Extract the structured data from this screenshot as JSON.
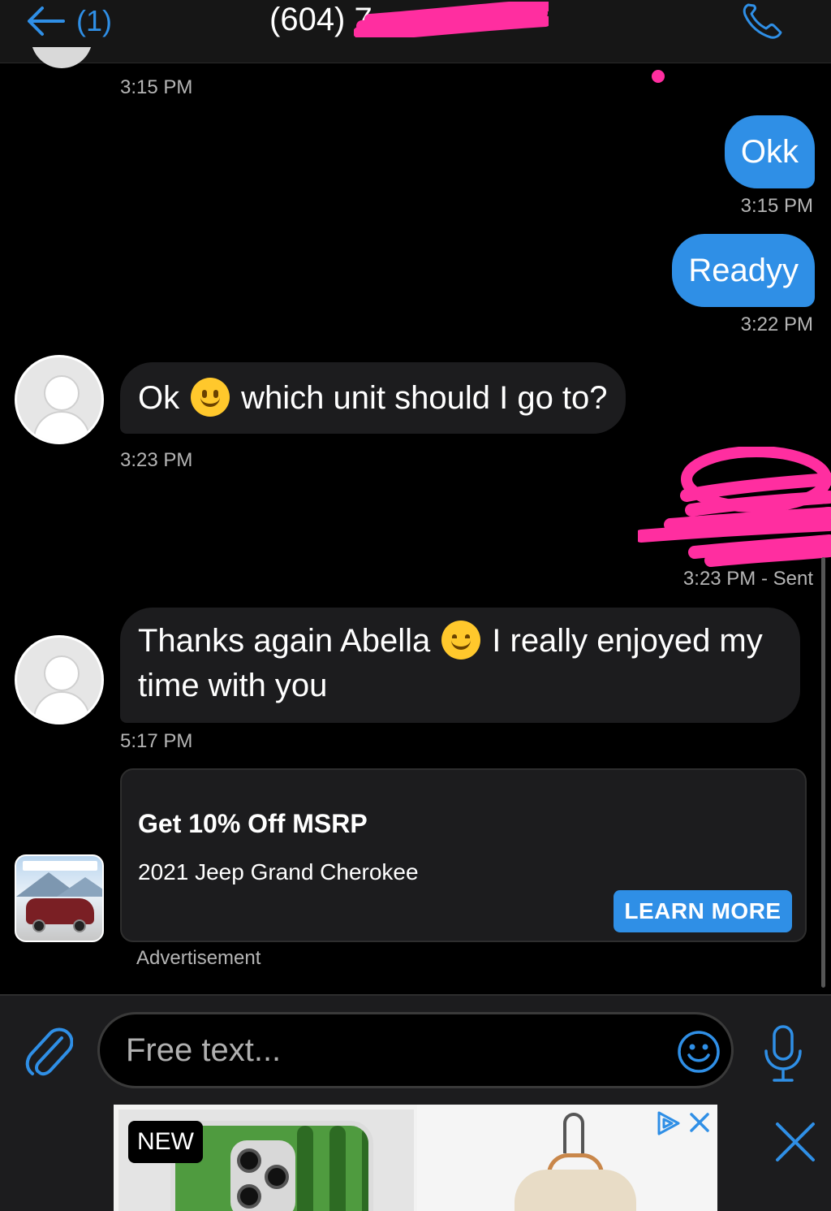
{
  "header": {
    "back_count": "(1)",
    "contact_number": "(604) 7",
    "icons": {
      "back": "arrow-left-icon",
      "call": "phone-icon"
    }
  },
  "thread": {
    "messages": [
      {
        "direction": "in",
        "time": "3:15 PM"
      },
      {
        "direction": "out",
        "text": "Okk",
        "time": "3:15 PM"
      },
      {
        "direction": "out",
        "text": "Readyy",
        "time": "3:22 PM"
      },
      {
        "direction": "in",
        "text_before": "Ok",
        "emoji": "slightly-smiling-face",
        "text_after": "which unit should I go to?",
        "time": "3:23 PM"
      },
      {
        "direction": "out",
        "redacted": true,
        "time": "3:23 PM - Sent"
      },
      {
        "direction": "in",
        "text_before": "Thanks again Abella",
        "emoji": "smiling-face-with-smiling-eyes",
        "text_after": "I really enjoyed my time with you",
        "time": "5:17 PM"
      }
    ]
  },
  "ad_card": {
    "headline": "Get 10% Off MSRP",
    "subtitle": "2021 Jeep Grand Cherokee",
    "cta": "LEARN MORE",
    "label": "Advertisement"
  },
  "composer": {
    "placeholder": "Free text...",
    "icons": {
      "attach": "paperclip-icon",
      "emoji": "smiley-icon",
      "mic": "microphone-icon"
    }
  },
  "banner_ad": {
    "tag": "NEW",
    "icons": {
      "adchoices": "adchoices-icon",
      "close": "close-icon"
    }
  },
  "colors": {
    "accent": "#2f8fe6",
    "background": "#000000",
    "incoming_bubble": "#1c1c1e",
    "redaction": "#ff2ea0"
  }
}
